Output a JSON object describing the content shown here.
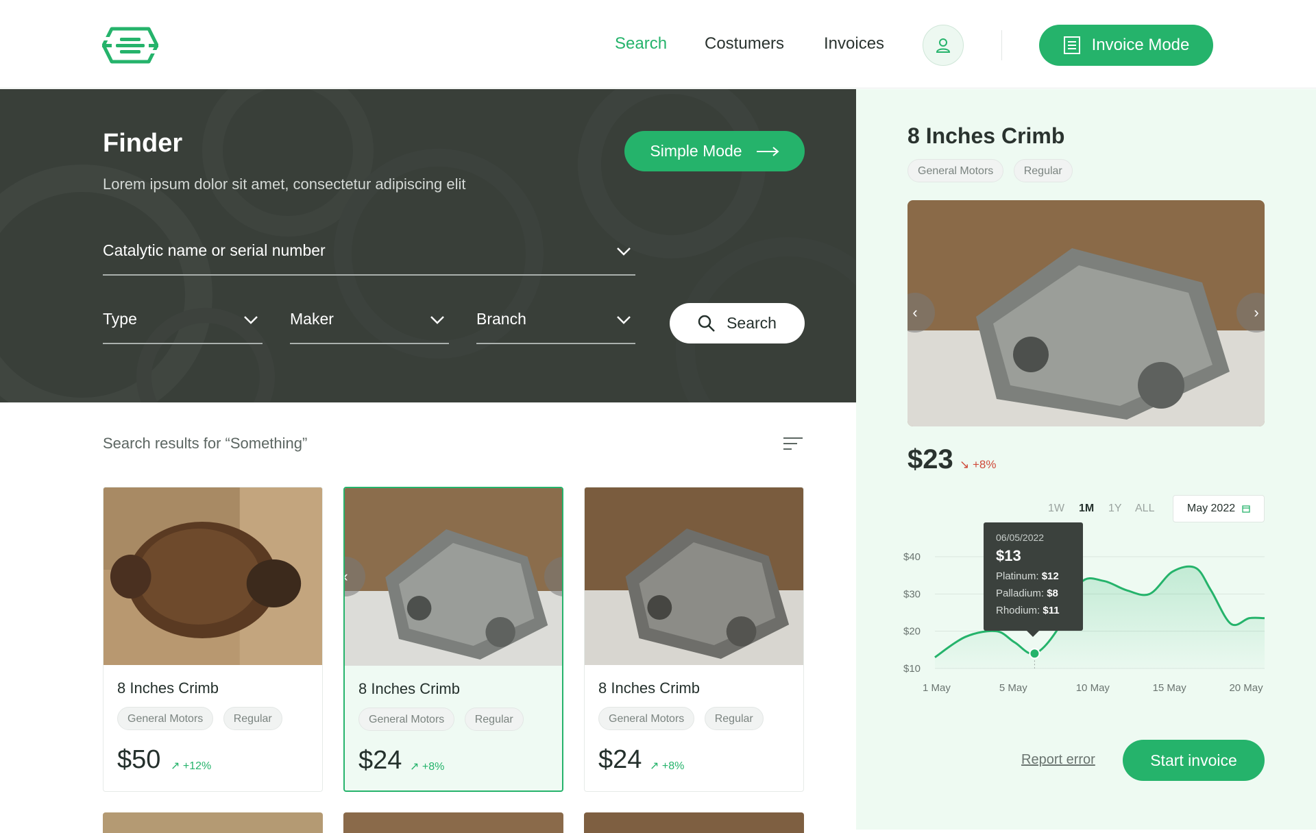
{
  "nav": {
    "links": [
      "Search",
      "Costumers",
      "Invoices"
    ],
    "invoice_mode_label": "Invoice Mode",
    "accent_color": "#25b36b"
  },
  "hero": {
    "title": "Finder",
    "subtitle": "Lorem ipsum dolor sit amet, consectetur adipiscing elit",
    "simple_mode_label": "Simple Mode",
    "catalytic_placeholder": "Catalytic name or serial number",
    "type_label": "Type",
    "maker_label": "Maker",
    "branch_label": "Branch",
    "search_label": "Search"
  },
  "results": {
    "title": "Search results for “Something”",
    "cards": [
      {
        "name": "8 Inches Crimb",
        "tags": [
          "General Motors",
          "Regular"
        ],
        "price": "$50",
        "change": "+12%"
      },
      {
        "name": "8 Inches Crimb",
        "tags": [
          "General Motors",
          "Regular"
        ],
        "price": "$24",
        "change": "+8%",
        "selected": true
      },
      {
        "name": "8 Inches Crimb",
        "tags": [
          "General Motors",
          "Regular"
        ],
        "price": "$24",
        "change": "+8%"
      }
    ]
  },
  "detail": {
    "title": "8 Inches Crimb",
    "tags": [
      "General Motors",
      "Regular"
    ],
    "price": "$23",
    "change": "+8%",
    "ranges": [
      "1W",
      "1M",
      "1Y",
      "ALL"
    ],
    "active_range": "1M",
    "date_picker": "May 2022",
    "report_error_label": "Report error",
    "start_invoice_label": "Start invoice",
    "tooltip": {
      "date": "06/05/2022",
      "value": "$13",
      "rows": [
        {
          "label": "Platinum:",
          "value": "$12"
        },
        {
          "label": "Palladium:",
          "value": "$8"
        },
        {
          "label": "Rhodium:",
          "value": "$11"
        }
      ]
    }
  },
  "chart_data": {
    "type": "area",
    "x_ticks": [
      "1 May",
      "5  May",
      "10 May",
      "15 May",
      "20 May"
    ],
    "y_ticks": [
      "$10",
      "$20",
      "$30",
      "$40"
    ],
    "ylim": [
      10,
      40
    ],
    "x": [
      0,
      2,
      4,
      5.2,
      6.5,
      8,
      9.5,
      11,
      12.5,
      14,
      15.5,
      17,
      18,
      19.3,
      20.5,
      21.5
    ],
    "values": [
      13,
      18.5,
      20,
      17,
      14,
      20.5,
      33,
      33.5,
      31,
      30,
      36,
      37,
      31,
      22,
      23.5,
      23.5
    ],
    "highlight_index": 4,
    "grid": true,
    "color": "#25b36b"
  }
}
